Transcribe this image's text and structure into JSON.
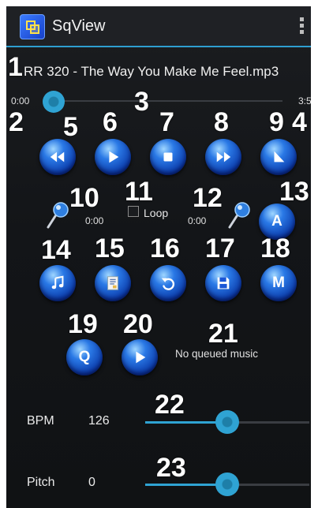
{
  "app": {
    "title": "SqView"
  },
  "player": {
    "track_name": "RR 320 - The Way You Make Me Feel.mp3",
    "time_current": "0:00",
    "time_total": "3:5",
    "seek_fraction": 0.0,
    "loop_label": "Loop",
    "loop_checked": false,
    "pin_a_time": "0:00",
    "pin_b_time": "0:00",
    "queue_status": "No queued music"
  },
  "sliders": {
    "bpm_label": "BPM",
    "bpm_value": "126",
    "bpm_fraction": 0.5,
    "pitch_label": "Pitch",
    "pitch_value": "0",
    "pitch_fraction": 0.5
  },
  "buttons": {
    "a_label": "A",
    "m_label": "M",
    "q_label": "Q"
  },
  "annotations": [
    "1",
    "2",
    "3",
    "4",
    "5",
    "6",
    "7",
    "8",
    "9",
    "10",
    "11",
    "12",
    "13",
    "14",
    "15",
    "16",
    "17",
    "18",
    "19",
    "20",
    "21",
    "22",
    "23"
  ],
  "icons": {
    "rewind": "rewind-icon",
    "play": "play-icon",
    "stop": "stop-icon",
    "fast_forward": "fast-forward-icon",
    "ramp": "ramp-icon",
    "pin": "pushpin-icon",
    "music": "music-note-icon",
    "document": "document-icon",
    "undo": "undo-icon",
    "save": "floppy-disk-icon"
  },
  "colors": {
    "accent": "#2fa3d3",
    "button_blue": "#1a56d6",
    "background": "#15171a"
  }
}
